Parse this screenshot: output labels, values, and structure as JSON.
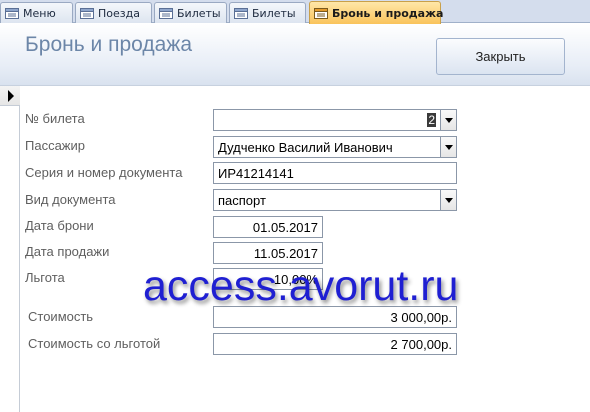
{
  "tabs": [
    {
      "label": "Меню",
      "active": false
    },
    {
      "label": "Поезда",
      "active": false
    },
    {
      "label": "Билеты",
      "active": false
    },
    {
      "label": "Билеты",
      "active": false
    },
    {
      "label": "Бронь и продажа",
      "active": true
    }
  ],
  "header": {
    "title": "Бронь и продажа",
    "close_label": "Закрыть"
  },
  "form": {
    "ticket_no": {
      "label": "№ билета",
      "value": "2"
    },
    "passenger": {
      "label": "Пассажир",
      "value": "Дудченко Василий Иванович"
    },
    "doc_number": {
      "label": "Серия и номер документа",
      "value": "ИР41214141"
    },
    "doc_type": {
      "label": "Вид документа",
      "value": "паспорт"
    },
    "booking_date": {
      "label": "Дата брони",
      "value": "01.05.2017"
    },
    "sale_date": {
      "label": "Дата продажи",
      "value": "11.05.2017"
    },
    "discount": {
      "label": "Льгота",
      "value": "10,00%"
    },
    "cost": {
      "label": "Стоимость",
      "value": "3 000,00р."
    },
    "cost_discounted": {
      "label": "Стоимость со льготой",
      "value": "2 700,00р."
    }
  },
  "watermark": "access.avorut.ru",
  "icons": {
    "tab_icon": "form-icon",
    "record": "record-selector-arrow-icon",
    "dropdown": "chevron-down-icon"
  },
  "colors": {
    "active_tab": "#f9c35b",
    "title": "#6c86a8",
    "watermark": "#1f1fd2"
  }
}
